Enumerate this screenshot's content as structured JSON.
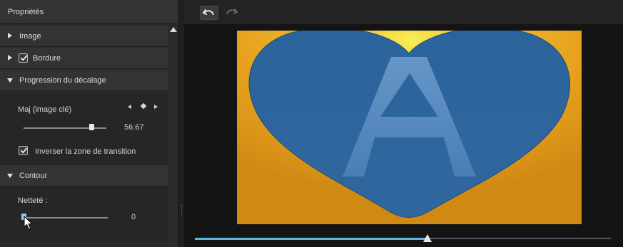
{
  "panel": {
    "title": "Propriétés",
    "sections": {
      "image": {
        "label": "Image",
        "expanded": false
      },
      "bordure": {
        "label": "Bordure",
        "expanded": false,
        "checked": true
      },
      "progression": {
        "label": "Progression du décalage",
        "expanded": true
      },
      "contour": {
        "label": "Contour",
        "expanded": true
      }
    },
    "maj": {
      "label": "Maj (image clé)",
      "value": "56.67",
      "slider_fraction": 0.82
    },
    "inverser": {
      "label": "Inverser la zone de transition",
      "checked": true
    },
    "nettete": {
      "label": "Netteté :",
      "value": "0",
      "slider_fraction": 0.0
    }
  },
  "toolbar": {
    "undo_icon": "undo-icon",
    "redo_icon": "redo-icon"
  },
  "preview": {
    "letter": "A",
    "colors": {
      "background": "#e8a21e",
      "background_light": "#f5e84a",
      "heart": "#2f6aa3",
      "letter": "#5b8fc4"
    }
  },
  "timeline": {
    "progress_fraction": 0.56,
    "accent": "#5bb7d9"
  }
}
